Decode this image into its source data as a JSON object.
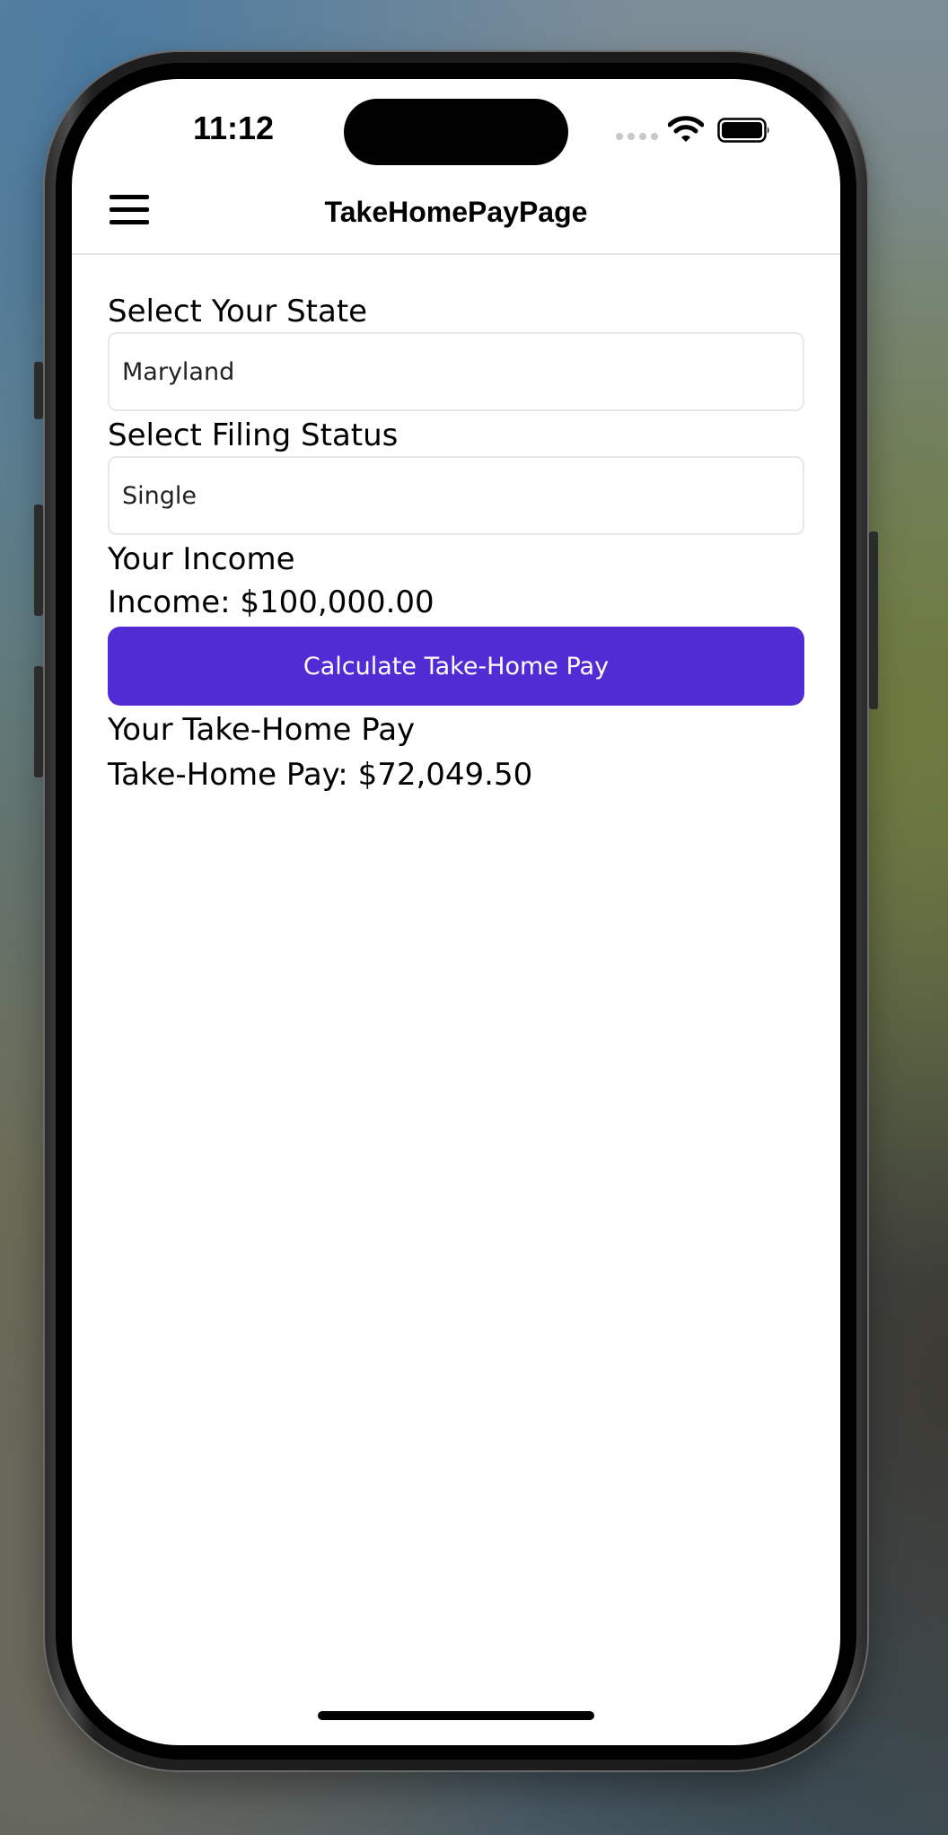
{
  "status_bar": {
    "time": "11:12"
  },
  "nav": {
    "title": "TakeHomePayPage",
    "menu_icon": "hamburger-menu-icon"
  },
  "form": {
    "state_label": "Select Your State",
    "state_value": "Maryland",
    "filing_label": "Select Filing Status",
    "filing_value": "Single",
    "income_label": "Your Income",
    "income_text": "Income: $100,000.00",
    "calculate_button_label": "Calculate Take-Home Pay",
    "result_label": "Your Take-Home Pay",
    "result_text": "Take-Home Pay: $72,049.50"
  },
  "colors": {
    "primary_button": "#512bd4",
    "screen_background": "#ffffff"
  }
}
